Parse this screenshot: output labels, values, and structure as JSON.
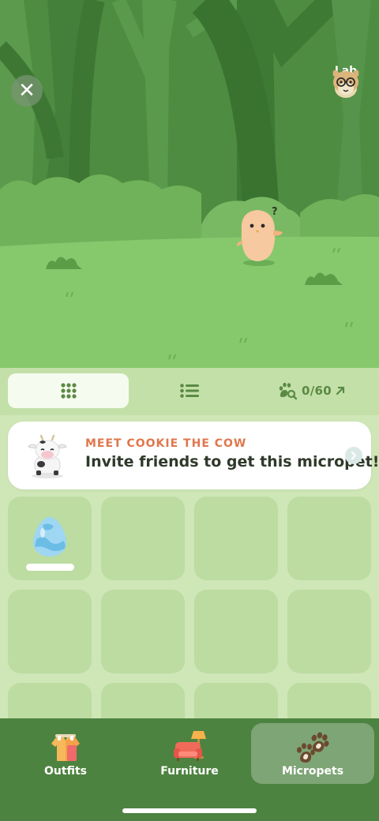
{
  "scene": {
    "lab_label": "Lab",
    "pet_thought": "?"
  },
  "toolbar": {
    "views": [
      "grid-view",
      "list-view"
    ],
    "collection_count": "0/60"
  },
  "banner": {
    "kicker": "MEET COOKIE THE COW",
    "text": "Invite friends to get this micropet!"
  },
  "grid": {
    "slot_count": 12,
    "filled_slots": [
      {
        "item": "egg",
        "color": "#9fd6f2"
      }
    ]
  },
  "bottom_nav": {
    "tabs": [
      {
        "label": "Outfits",
        "icon": "shirt-icon"
      },
      {
        "label": "Furniture",
        "icon": "couch-lamp-icon"
      },
      {
        "label": "Micropets",
        "icon": "paw-prints-icon",
        "selected": true
      }
    ]
  },
  "colors": {
    "forest": "#4f8f42",
    "meadow": "#86c96d",
    "panel": "#cfe6b7",
    "slot": "#bcdca2",
    "nav": "#4d8340",
    "accent": "#e0774d"
  }
}
